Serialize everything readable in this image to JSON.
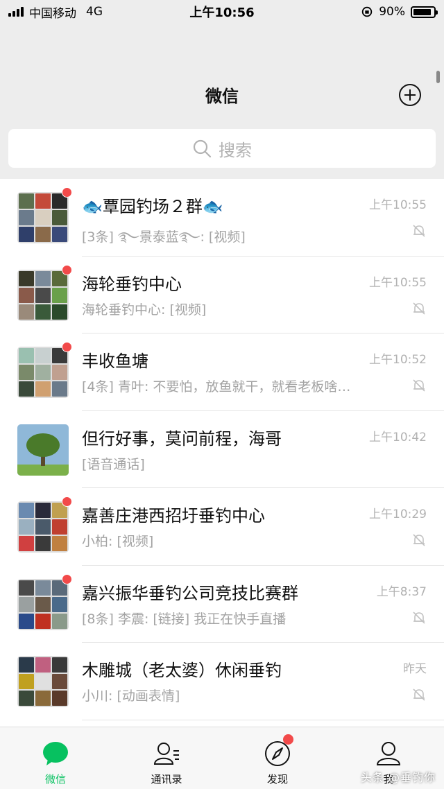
{
  "status": {
    "carrier": "中国移动",
    "network": "4G",
    "time": "上午10:56",
    "battery": "90%",
    "battery_level": 0.9
  },
  "header": {
    "title": "微信",
    "add_icon": "plus-circle-icon"
  },
  "search": {
    "placeholder": "搜索",
    "icon": "search-icon"
  },
  "chats": [
    {
      "name": "🐟覃园钓场２群🐟",
      "time": "上午10:55",
      "message": "[3条] ࿐景泰蓝࿐: [视频]",
      "unread_dot": true,
      "muted": true,
      "avatar_colors": [
        "#5c6f4e",
        "#c44a3a",
        "#2a2a2a",
        "#6b7b8c",
        "#d9cfc0",
        "#4a5a3a",
        "#2f3f6a",
        "#8a6a4a",
        "#3a4a7a"
      ]
    },
    {
      "name": "海轮垂钓中心",
      "time": "上午10:55",
      "message": "海轮垂钓中心: [视频]",
      "unread_dot": true,
      "muted": true,
      "avatar_colors": [
        "#3a3a2a",
        "#7a8a9a",
        "#5a6a3a",
        "#8a5a4a",
        "#4a4a4a",
        "#6aa04a",
        "#9a8a7a",
        "#3a5a3a",
        "#2a4a2a"
      ]
    },
    {
      "name": "丰收鱼塘",
      "time": "上午10:52",
      "message": "[4条] 青叶: 不要怕，放鱼就干，就看老板啥…",
      "unread_dot": true,
      "muted": true,
      "avatar_colors": [
        "#9ac0b0",
        "#c8d0d0",
        "#3a3a3a",
        "#7a8a6a",
        "#a0b0a0",
        "#c0a090",
        "#3a4a3a",
        "#d0a070",
        "#6a7a8a"
      ]
    },
    {
      "name": "但行好事，莫问前程，海哥",
      "time": "上午10:42",
      "message": "[语音通话]",
      "unread_dot": false,
      "muted": false,
      "avatar_colors": []
    },
    {
      "name": "嘉善庄港西招圩垂钓中心",
      "time": "上午10:29",
      "message": "小柏: [视频]",
      "unread_dot": true,
      "muted": true,
      "avatar_colors": [
        "#6a8ab0",
        "#2a2a3a",
        "#c0a050",
        "#9ab0c0",
        "#4a5a6a",
        "#c04030",
        "#d04040",
        "#3a3a3a",
        "#c08040"
      ]
    },
    {
      "name": "嘉兴振华垂钓公司竞技比赛群",
      "time": "上午8:37",
      "message": "[8条] 李震: [链接] 我正在快手直播",
      "unread_dot": true,
      "muted": true,
      "avatar_colors": [
        "#4a4a4a",
        "#7a8a9a",
        "#5a6a7a",
        "#9aa0a0",
        "#6a5a4a",
        "#4a6a8a",
        "#2a4a8a",
        "#c03020",
        "#8a9a8a"
      ]
    },
    {
      "name": "木雕城（老太婆）休闲垂钓",
      "time": "昨天",
      "message": "小川: [动画表情]",
      "unread_dot": false,
      "muted": true,
      "avatar_colors": [
        "#2a3a4a",
        "#c06080",
        "#3a3a3a",
        "#c0a020",
        "#e0e0e0",
        "#6a4a3a",
        "#3a4a3a",
        "#8a6a3a",
        "#5a3a2a"
      ]
    }
  ],
  "tabs": [
    {
      "label": "微信",
      "icon": "chat-bubble-icon",
      "active": true,
      "dot": false
    },
    {
      "label": "通讯录",
      "icon": "contacts-icon",
      "active": false,
      "dot": false
    },
    {
      "label": "发现",
      "icon": "compass-icon",
      "active": false,
      "dot": true
    },
    {
      "label": "我",
      "icon": "person-icon",
      "active": false,
      "dot": false
    }
  ],
  "watermark": "头条 @垂钓你",
  "colors": {
    "accent": "#07c160",
    "badge": "#f24a4a",
    "background": "#ededed"
  }
}
